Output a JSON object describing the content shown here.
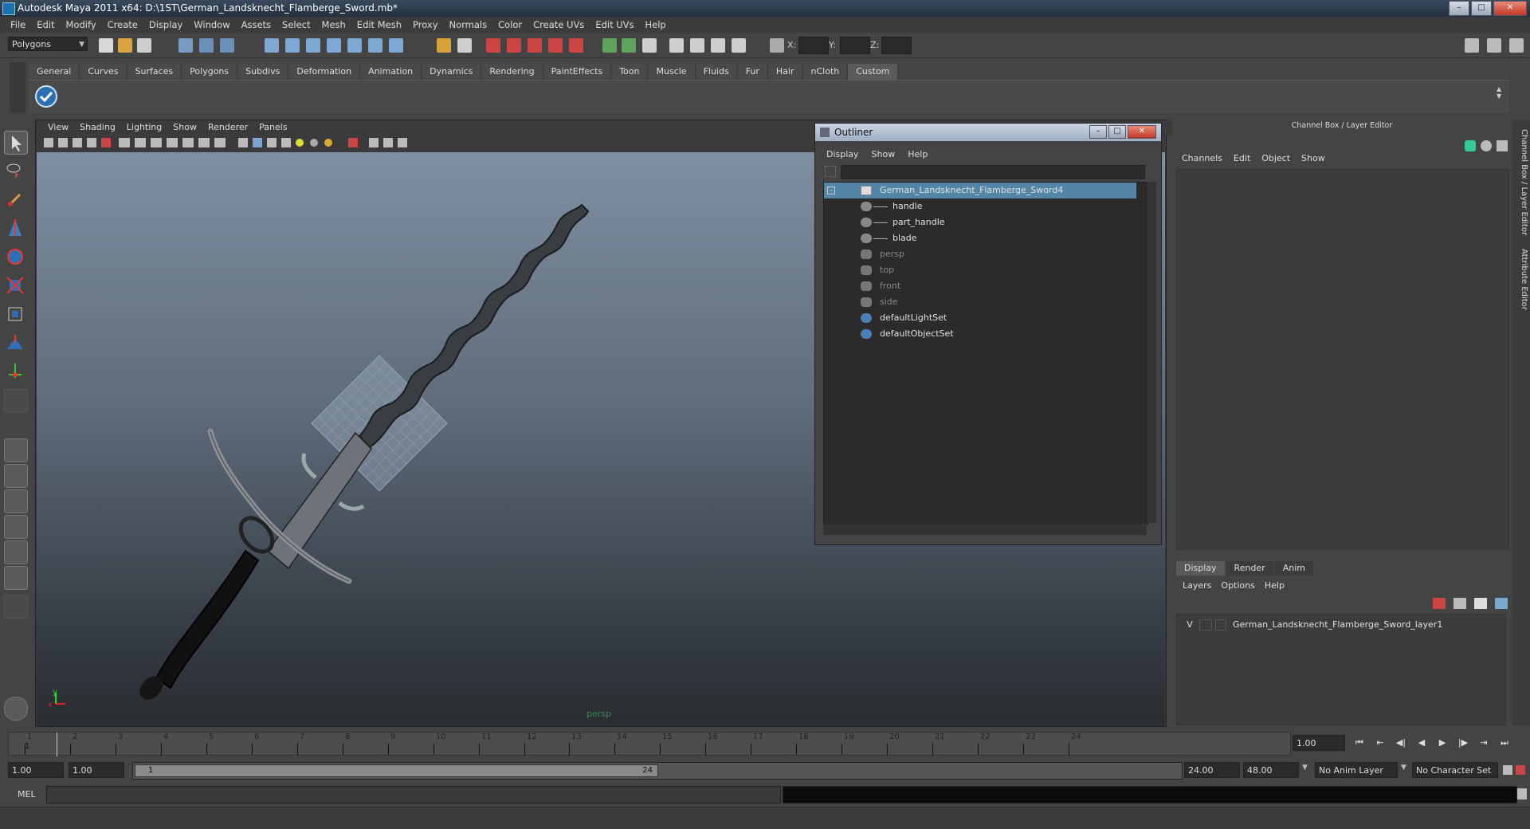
{
  "window": {
    "title": "Autodesk Maya 2011 x64: D:\\1ST\\German_Landsknecht_Flamberge_Sword.mb*",
    "minimize": "–",
    "maximize": "□",
    "close": "✕"
  },
  "menubar": [
    "File",
    "Edit",
    "Modify",
    "Create",
    "Display",
    "Window",
    "Assets",
    "Select",
    "Mesh",
    "Edit Mesh",
    "Proxy",
    "Normals",
    "Color",
    "Create UVs",
    "Edit UVs",
    "Help"
  ],
  "statusline": {
    "mode": "Polygons",
    "x_label": "X:",
    "y_label": "Y:",
    "z_label": "Z:"
  },
  "shelf": {
    "tabs": [
      "General",
      "Curves",
      "Surfaces",
      "Polygons",
      "Subdivs",
      "Deformation",
      "Animation",
      "Dynamics",
      "Rendering",
      "PaintEffects",
      "Toon",
      "Muscle",
      "Fluids",
      "Fur",
      "Hair",
      "nCloth",
      "Custom"
    ],
    "active_tab": "Custom"
  },
  "viewport": {
    "menu": [
      "View",
      "Shading",
      "Lighting",
      "Show",
      "Renderer",
      "Panels"
    ],
    "camera": "persp"
  },
  "outliner": {
    "title": "Outliner",
    "menu": [
      "Display",
      "Show",
      "Help"
    ],
    "items": [
      {
        "label": "German_Landsknecht_Flamberge_Sword4",
        "selected": true
      },
      {
        "label": "handle"
      },
      {
        "label": "part_handle"
      },
      {
        "label": "blade"
      },
      {
        "label": "persp",
        "dim": true
      },
      {
        "label": "top",
        "dim": true
      },
      {
        "label": "front",
        "dim": true
      },
      {
        "label": "side",
        "dim": true
      },
      {
        "label": "defaultLightSet"
      },
      {
        "label": "defaultObjectSet"
      }
    ]
  },
  "channelbox": {
    "title": "Channel Box / Layer Editor",
    "menu": [
      "Channels",
      "Edit",
      "Object",
      "Show"
    ]
  },
  "layer_editor": {
    "tabs": [
      "Display",
      "Render",
      "Anim"
    ],
    "active_tab": "Display",
    "menu": [
      "Layers",
      "Options",
      "Help"
    ],
    "layer": {
      "visible": "V",
      "name": "German_Landsknecht_Flamberge_Sword_layer1"
    }
  },
  "side_tabs": [
    "Channel Box / Layer Editor",
    "Attribute Editor"
  ],
  "timeline": {
    "ticks": [
      "1",
      "2",
      "3",
      "4",
      "5",
      "6",
      "7",
      "8",
      "9",
      "10",
      "11",
      "12",
      "13",
      "14",
      "15",
      "16",
      "17",
      "18",
      "19",
      "20",
      "21",
      "22",
      "23",
      "24"
    ],
    "current_frame": "1",
    "current_frame_field": "1.00"
  },
  "range": {
    "start": "1.00",
    "start_inner": "1.00",
    "handle_start": "1",
    "handle_end": "24",
    "end_inner": "24.00",
    "end": "48.00",
    "anim_layer": "No Anim Layer",
    "char_set": "No Character Set"
  },
  "cmdline": {
    "label": "MEL"
  },
  "colors": {
    "accent": "#5285a6",
    "viewport_top": "#7f8fa2",
    "viewport_bottom": "#2a2d31"
  }
}
